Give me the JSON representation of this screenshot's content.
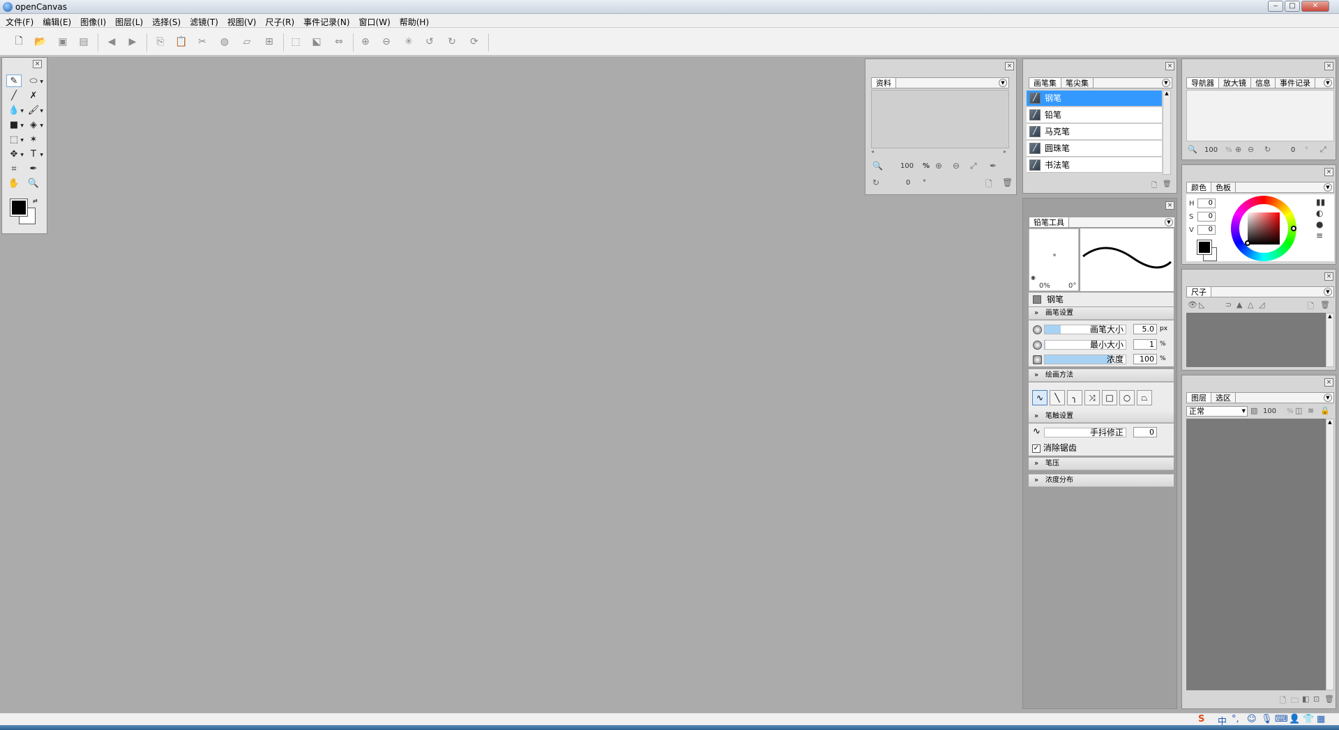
{
  "window": {
    "title": "openCanvas",
    "min": "‒",
    "max": "□",
    "close": "✕"
  },
  "menu": [
    "文件(F)",
    "编辑(E)",
    "图像(I)",
    "图层(L)",
    "选择(S)",
    "滤镜(T)",
    "视图(V)",
    "尺子(R)",
    "事件记录(N)",
    "窗口(W)",
    "帮助(H)"
  ],
  "material_panel": {
    "tab": "资料",
    "zoom": "100",
    "zoom_unit": "%",
    "rotation": "0",
    "rotation_unit": "°"
  },
  "brush_panel": {
    "tabs": [
      "画笔集",
      "笔尖集"
    ],
    "brushes": [
      "钢笔",
      "铅笔",
      "马克笔",
      "圆珠笔",
      "书法笔"
    ],
    "selected_index": 0
  },
  "tool_panel": {
    "tab": "铅笔工具",
    "preview_opacity": "0%",
    "preview_angle": "0°",
    "current_brush": "钢笔",
    "sections": {
      "brush_settings": "画笔设置",
      "draw_method": "绘画方法",
      "stroke_settings": "笔触设置",
      "pressure": "笔压",
      "density_dist": "浓度分布"
    },
    "brush_size": {
      "label": "画笔大小",
      "value": "5.0",
      "unit": "px",
      "fill": 0.2
    },
    "min_size": {
      "label": "最小大小",
      "value": "1",
      "unit": "%",
      "fill": 0.01
    },
    "density": {
      "label": "浓度",
      "value": "100",
      "unit": "%",
      "fill": 0.83
    },
    "stabilizer": {
      "label": "手抖修正",
      "value": "0"
    },
    "antialias": {
      "label": "消除锯齿",
      "checked": true
    }
  },
  "navigator_panel": {
    "tabs": [
      "导航器",
      "放大镜",
      "信息",
      "事件记录"
    ],
    "zoom": "100",
    "zoom_unit": "%",
    "rotation": "0",
    "rotation_unit": "°"
  },
  "color_panel": {
    "tabs": [
      "颜色",
      "色板"
    ],
    "h_label": "H",
    "h": "0",
    "s_label": "S",
    "s": "0",
    "v_label": "V",
    "v": "0"
  },
  "ruler_panel": {
    "tab": "尺子"
  },
  "layer_panel": {
    "tabs": [
      "图层",
      "选区"
    ],
    "blend_mode": "正常",
    "opacity": "100",
    "opacity_unit": "%"
  },
  "colors": {
    "workspace": "#ababab",
    "selection": "#3399ff",
    "slider_fill": "#a8d2f4"
  }
}
